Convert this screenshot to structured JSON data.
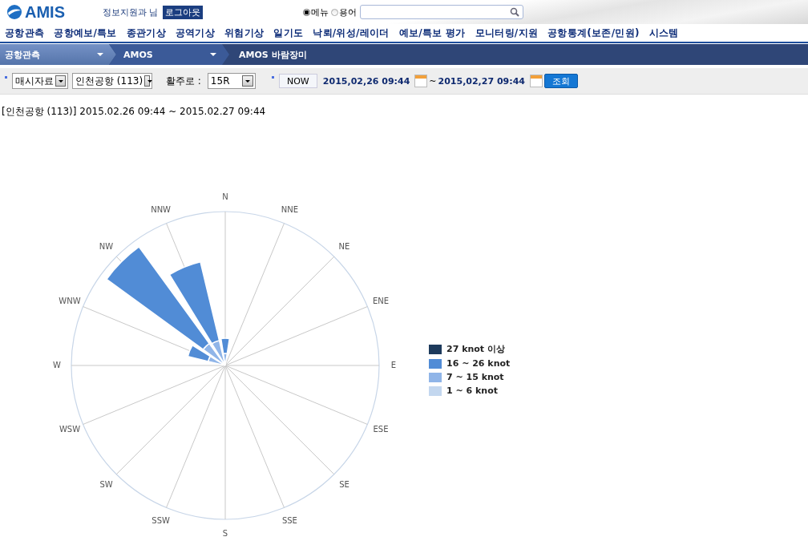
{
  "header": {
    "logo": "AMIS",
    "user": "정보지원과 님",
    "logout": "로그아웃",
    "search_scope": [
      {
        "label": "메뉴",
        "selected": true
      },
      {
        "label": "용어",
        "selected": false
      }
    ]
  },
  "menu": [
    "공항관측",
    "공항예보/특보",
    "종관기상",
    "공역기상",
    "위험기상",
    "일기도",
    "낙뢰/위성/레이더",
    "예보/특보 평가",
    "모니터링/지원",
    "공항통계(보존/민원)",
    "시스템"
  ],
  "breadcrumb": [
    {
      "label": "공항관측",
      "has_menu": true
    },
    {
      "label": "AMOS",
      "has_menu": true
    },
    {
      "label": "AMOS 바람장미",
      "has_menu": false
    }
  ],
  "toolbar": {
    "data_type": "매시자료",
    "airport": "인천공항 (113)",
    "runway_label": "활주로 :",
    "runway": "15R",
    "now_button": "NOW",
    "start": "2015,02,26 09:44",
    "separator": "~",
    "end": "2015,02,27 09:44",
    "search_button": "조회"
  },
  "result_title": "[인천공항 (113)] 2015.02.26 09:44 ~ 2015.02.27 09:44",
  "wind_rose": {
    "directions": [
      "N",
      "NNE",
      "NE",
      "ENE",
      "E",
      "ESE",
      "SE",
      "SSE",
      "S",
      "SSW",
      "SW",
      "WSW",
      "W",
      "WNW",
      "NW",
      "NNW"
    ],
    "legend": [
      {
        "label": "27 knot 이상",
        "color": "#1d3a5c"
      },
      {
        "label": "16 ~ 26 knot",
        "color": "#518cd6"
      },
      {
        "label": "7 ~ 15 knot",
        "color": "#90b5e8"
      },
      {
        "label": "1 ~ 6 knot",
        "color": "#c3d7ef"
      }
    ]
  }
}
